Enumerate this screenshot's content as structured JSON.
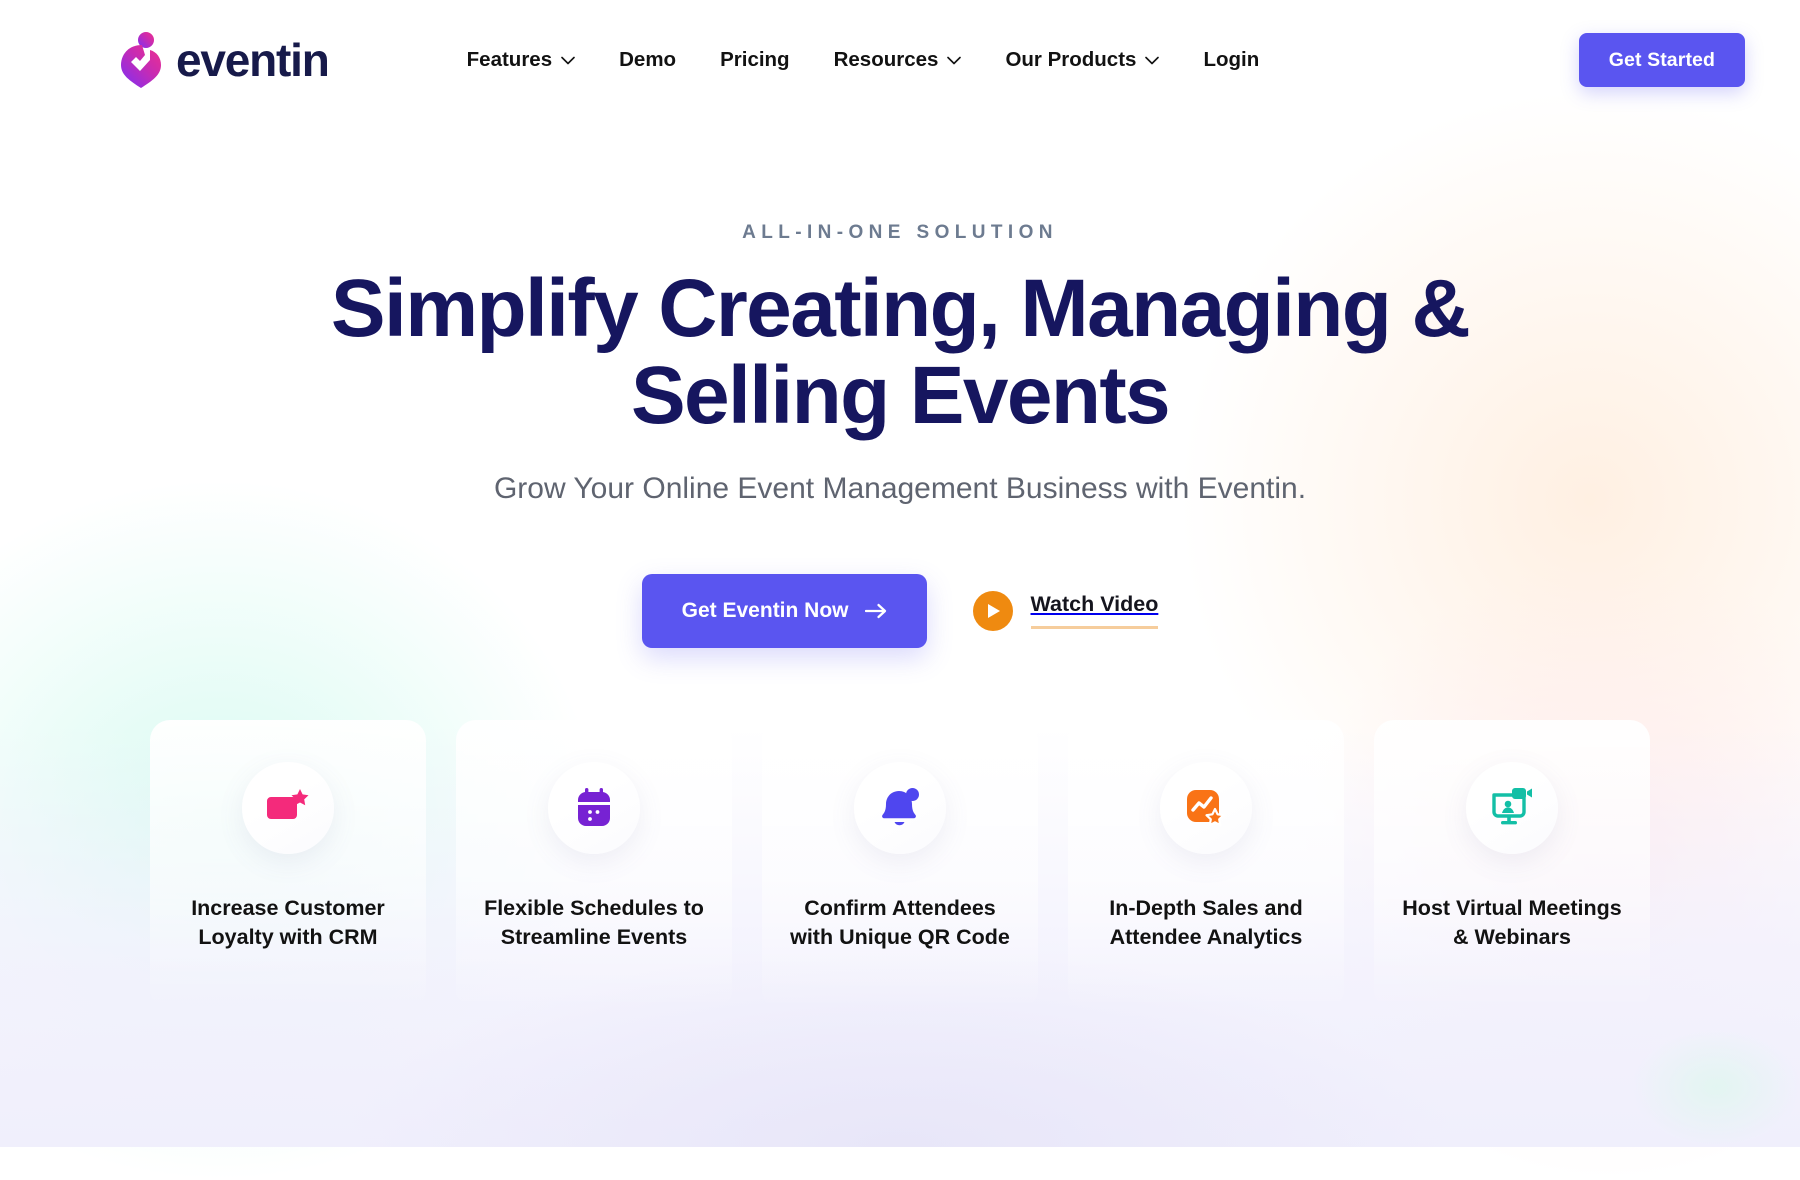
{
  "header": {
    "logo": {
      "name": "eventin",
      "icon": "eventin-pin-logo-icon"
    },
    "nav": [
      {
        "label": "Features",
        "has_dropdown": true,
        "icon": "chevron-down-icon"
      },
      {
        "label": "Demo",
        "has_dropdown": false,
        "icon": ""
      },
      {
        "label": "Pricing",
        "has_dropdown": false,
        "icon": ""
      },
      {
        "label": "Resources",
        "has_dropdown": true,
        "icon": "chevron-down-icon"
      },
      {
        "label": "Our Products",
        "has_dropdown": true,
        "icon": "chevron-down-icon"
      },
      {
        "label": "Login",
        "has_dropdown": false,
        "icon": ""
      }
    ],
    "cta": {
      "label": "Get Started",
      "color": "#5a55f0"
    }
  },
  "hero": {
    "eyebrow": "ALL-IN-ONE SOLUTION",
    "title_line1": "Simplify Creating, Managing &",
    "title_line2": "Selling Events",
    "title_color": "#16165f",
    "subtitle": "Grow Your Online Event Management Business with Eventin.",
    "primary_cta": {
      "label": "Get Eventin Now",
      "icon": "arrow-right-icon",
      "color": "#5a55f0"
    },
    "secondary_cta": {
      "label": "Watch Video",
      "icon": "play-icon",
      "color": "#ef8a10"
    }
  },
  "features": [
    {
      "title_line1": "Increase Customer",
      "title_line2": "Loyalty with CRM",
      "icon": "user-star-icon",
      "color": "#f42a7b"
    },
    {
      "title_line1": "Flexible Schedules to",
      "title_line2": "Streamline Events",
      "icon": "calendar-icon",
      "color": "#7722d3"
    },
    {
      "title_line1": "Confirm Attendees",
      "title_line2": "with Unique QR Code",
      "icon": "bell-alert-icon",
      "color": "#4f46ef"
    },
    {
      "title_line1": "In-Depth Sales and",
      "title_line2": "Attendee Analytics",
      "icon": "analytics-star-icon",
      "color": "#f97316"
    },
    {
      "title_line1": "Host Virtual Meetings",
      "title_line2": "& Webinars",
      "icon": "webinar-screen-icon",
      "color": "#13bfa6"
    }
  ]
}
